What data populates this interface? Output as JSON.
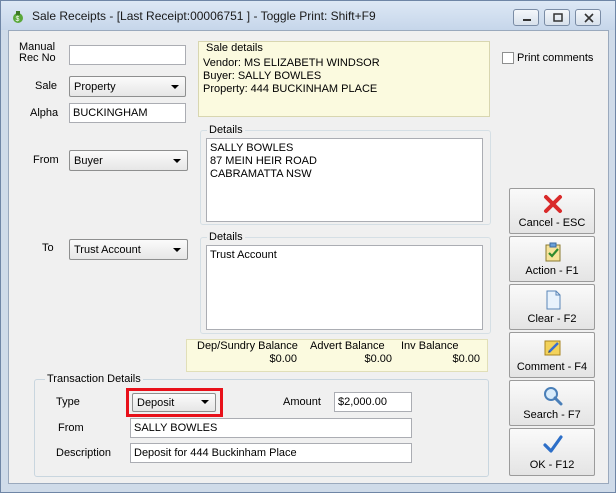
{
  "window": {
    "title": "Sale Receipts - [Last Receipt:00006751 ] - Toggle Print: Shift+F9"
  },
  "form": {
    "manual_rec_no_label_line1": "Manual",
    "manual_rec_no_label_line2": "Rec No",
    "manual_rec_no_value": "",
    "sale_label": "Sale",
    "sale_value": "Property",
    "alpha_label": "Alpha",
    "alpha_value": "BUCKINGHAM",
    "from_label": "From",
    "from_value": "Buyer",
    "to_label": "To",
    "to_value": "Trust Account"
  },
  "sale_details": {
    "title": "Sale details",
    "line1": "Vendor: MS ELIZABETH WINDSOR",
    "line2": "Buyer: SALLY BOWLES",
    "line3": "Property: 444 BUCKINHAM PLACE"
  },
  "print_comments": {
    "label": "Print comments",
    "checked": false
  },
  "from_details": {
    "title": "Details",
    "line1": "SALLY BOWLES",
    "line2": "87 MEIN HEIR ROAD",
    "line3": "CABRAMATTA  NSW"
  },
  "to_details": {
    "title": "Details",
    "line1": "Trust Account"
  },
  "balances": {
    "dep_sundry_label": "Dep/Sundry Balance",
    "dep_sundry_value": "$0.00",
    "advert_label": "Advert Balance",
    "advert_value": "$0.00",
    "inv_label": "Inv Balance",
    "inv_value": "$0.00"
  },
  "transaction": {
    "title": "Transaction Details",
    "type_label": "Type",
    "type_value": "Deposit",
    "amount_label": "Amount",
    "amount_value": "$2,000.00",
    "from_label": "From",
    "from_value": "SALLY BOWLES",
    "description_label": "Description",
    "description_value": "Deposit for 444 Buckinham Place"
  },
  "side_buttons": {
    "cancel": "Cancel - ESC",
    "action": "Action - F1",
    "clear": "Clear - F2",
    "comment": "Comment - F4",
    "search": "Search - F7",
    "ok": "OK - F12"
  },
  "colors": {
    "highlight": "#e8101a",
    "sale_details_bg": "#fbfadf",
    "cancel_icon": "#d92a2a",
    "ok_icon": "#2d6fc8"
  }
}
